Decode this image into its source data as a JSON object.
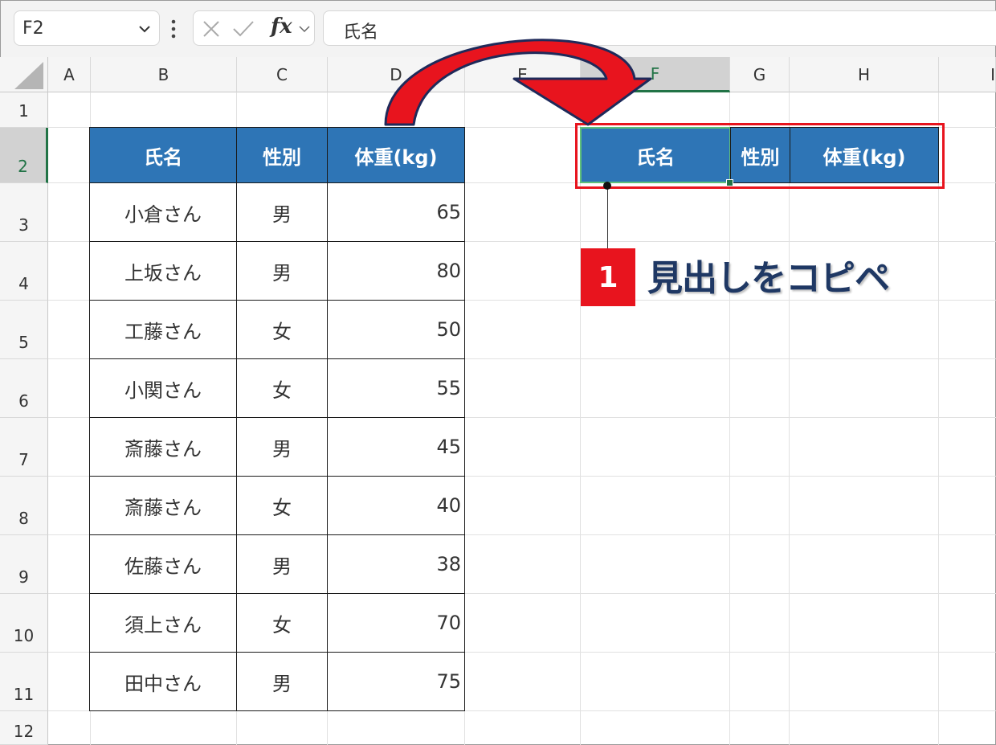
{
  "formula_bar": {
    "name_box": "F2",
    "fx_label": "fx",
    "formula_value": "氏名"
  },
  "columns": [
    "A",
    "B",
    "C",
    "D",
    "E",
    "F",
    "G",
    "H",
    "I"
  ],
  "rows": [
    "1",
    "2",
    "3",
    "4",
    "5",
    "6",
    "7",
    "8",
    "9",
    "10",
    "11",
    "12"
  ],
  "selected_column": "F",
  "selected_row": "2",
  "table": {
    "headers": [
      "氏名",
      "性別",
      "体重(kg)"
    ],
    "rows": [
      [
        "小倉さん",
        "男",
        "65"
      ],
      [
        "上坂さん",
        "男",
        "80"
      ],
      [
        "工藤さん",
        "女",
        "50"
      ],
      [
        "小関さん",
        "女",
        "55"
      ],
      [
        "斎藤さん",
        "男",
        "45"
      ],
      [
        "斎藤さん",
        "女",
        "40"
      ],
      [
        "佐藤さん",
        "男",
        "38"
      ],
      [
        "須上さん",
        "女",
        "70"
      ],
      [
        "田中さん",
        "男",
        "75"
      ]
    ]
  },
  "copied_headers": [
    "氏名",
    "性別",
    "体重(kg)"
  ],
  "annotation": {
    "step_number": "1",
    "label": "見出しをコピペ"
  },
  "colors": {
    "header_fill": "#2e75b6",
    "accent_red": "#e8141e",
    "excel_green": "#217346",
    "callout_text": "#1f3864"
  }
}
